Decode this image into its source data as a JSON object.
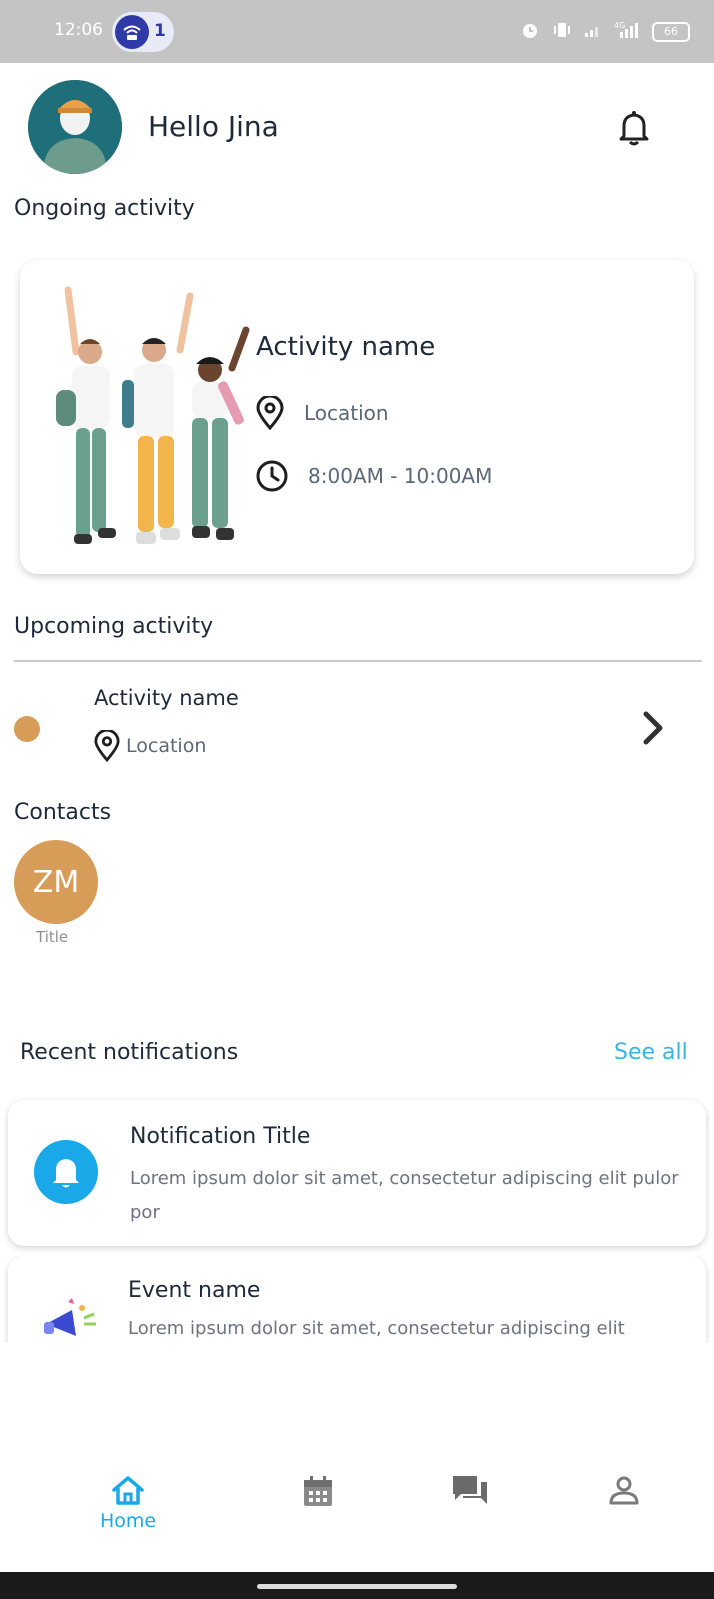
{
  "status_bar": {
    "time": "12:06",
    "notification_count": "1",
    "battery": "66"
  },
  "header": {
    "greeting": "Hello Jina"
  },
  "ongoing": {
    "section_title": "Ongoing activity",
    "activity_name": "Activity name",
    "location": "Location",
    "time": "8:00AM - 10:00AM"
  },
  "upcoming": {
    "section_title": "Upcoming activity",
    "activity_name": "Activity name",
    "location": "Location"
  },
  "contacts": {
    "section_title": "Contacts",
    "items": [
      {
        "initials": "ZM",
        "title": "Title",
        "color": "#d79c58"
      }
    ]
  },
  "notifications": {
    "section_title": "Recent notifications",
    "see_all": "See all",
    "items": [
      {
        "title": "Notification Title",
        "body": "Lorem ipsum dolor sit amet, consectetur adipiscing elit pulor por",
        "icon": "bell-icon"
      },
      {
        "title": "Event name",
        "body": "Lorem ipsum dolor sit amet, consectetur adipiscing elit",
        "icon": "megaphone-icon"
      }
    ]
  },
  "bottom_nav": {
    "items": [
      {
        "label": "Home",
        "icon": "home-icon",
        "active": true
      },
      {
        "label": "",
        "icon": "calendar-icon",
        "active": false
      },
      {
        "label": "",
        "icon": "chat-icon",
        "active": false
      },
      {
        "label": "",
        "icon": "profile-icon",
        "active": false
      }
    ]
  },
  "colors": {
    "accent": "#19a8e8",
    "link": "#39b5e0",
    "contact": "#d79c58",
    "status_bar": "#c4c4c4"
  }
}
